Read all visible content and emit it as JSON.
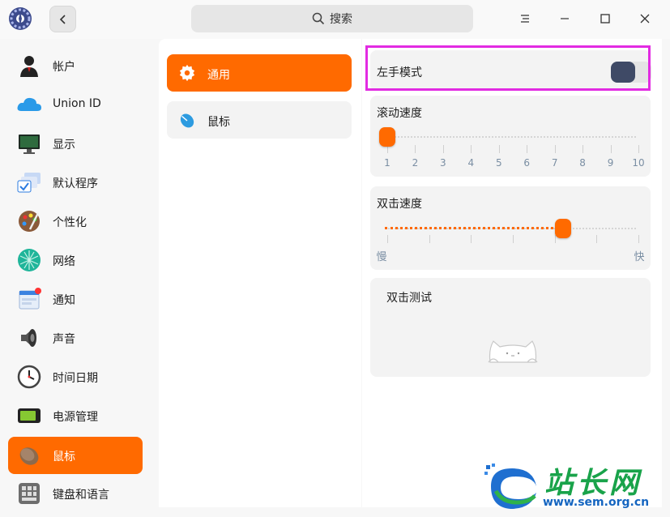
{
  "titlebar": {
    "search_placeholder": "搜索"
  },
  "sidebar": {
    "items": [
      {
        "label": "帐户",
        "icon": "account-icon"
      },
      {
        "label": "Union ID",
        "icon": "cloud-icon"
      },
      {
        "label": "显示",
        "icon": "display-icon"
      },
      {
        "label": "默认程序",
        "icon": "default-apps-icon"
      },
      {
        "label": "个性化",
        "icon": "palette-icon"
      },
      {
        "label": "网络",
        "icon": "network-icon"
      },
      {
        "label": "通知",
        "icon": "notification-icon"
      },
      {
        "label": "声音",
        "icon": "speaker-icon"
      },
      {
        "label": "时间日期",
        "icon": "clock-icon"
      },
      {
        "label": "电源管理",
        "icon": "battery-icon"
      },
      {
        "label": "鼠标",
        "icon": "mouse-icon",
        "active": true
      },
      {
        "label": "键盘和语言",
        "icon": "keyboard-icon"
      }
    ]
  },
  "middle": {
    "items": [
      {
        "label": "通用",
        "icon": "gear-icon",
        "active": true
      },
      {
        "label": "鼠标",
        "icon": "mouse-icon"
      }
    ]
  },
  "right": {
    "left_hand_mode": {
      "label": "左手模式",
      "enabled": false
    },
    "scroll_speed": {
      "label": "滚动速度",
      "value": 1,
      "ticks": [
        "1",
        "2",
        "3",
        "4",
        "5",
        "6",
        "7",
        "8",
        "9",
        "10"
      ]
    },
    "double_click_speed": {
      "label": "双击速度",
      "value_fraction": 0.7,
      "min_label": "慢",
      "max_label": "快"
    },
    "double_click_test": {
      "label": "双击测试"
    }
  },
  "watermark": {
    "text": "站长网",
    "url": "www.sem.org.cn"
  },
  "colors": {
    "accent": "#ff6a00",
    "toggle_knob": "#3f4a66",
    "highlight": "#e22be2"
  }
}
